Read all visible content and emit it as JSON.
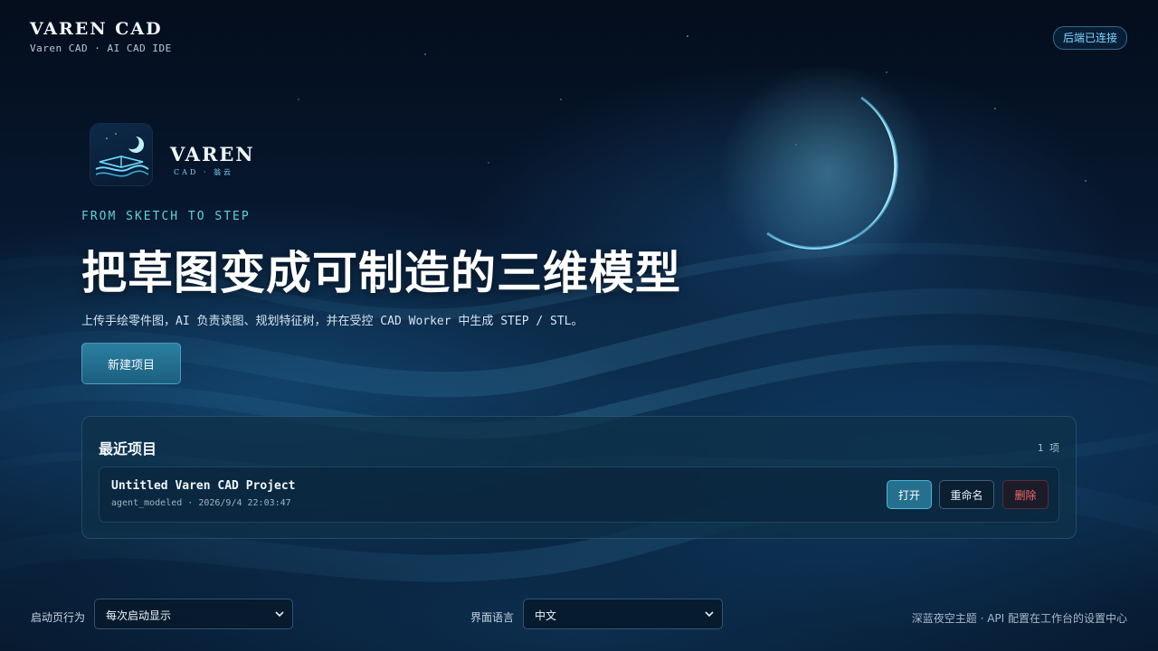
{
  "app": {
    "title": "VAREN CAD",
    "subtitle": "Varen CAD · AI CAD IDE",
    "status": "后端已连接"
  },
  "logo": {
    "word": "VAREN",
    "sub": "CAD · 翁云"
  },
  "hero": {
    "eyebrow": "FROM SKETCH TO STEP",
    "title": "把草图变成可制造的三维模型",
    "description": "上传手绘零件图，AI 负责读图、规划特征树，并在受控 CAD Worker 中生成 STEP / STL。",
    "new_project_label": "新建项目"
  },
  "recent": {
    "title": "最近项目",
    "count": "1 项",
    "projects": [
      {
        "name": "Untitled Varen CAD Project",
        "meta": "agent_modeled · 2026/9/4 22:03:47",
        "open_label": "打开",
        "rename_label": "重命名",
        "delete_label": "删除"
      }
    ]
  },
  "footer": {
    "startup_label": "启动页行为",
    "startup_value": "每次启动显示",
    "language_label": "界面语言",
    "language_value": "中文",
    "note": "深蓝夜空主题 · API 配置在工作台的设置中心"
  },
  "colors": {
    "accent": "#5fd3dc",
    "status": "#7fd6ff",
    "primary_button": "#25708f",
    "danger": "#ef6b6b",
    "background": "#061428"
  },
  "icons": {
    "logo": "moon-book-wave-icon",
    "select_chevron": "chevron-down-icon"
  }
}
